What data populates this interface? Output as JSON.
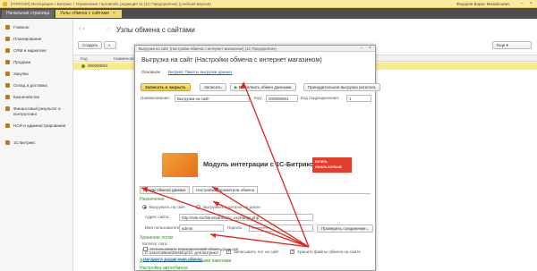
{
  "titlebar": {
    "title": "[УПРОЭП] Интеграция с Битрикс / Управление торговлей, редакция 11 (1С:Предприятие) (учебная версия)",
    "user": "Федоров Борис Михайлович"
  },
  "tabs": [
    {
      "label": "Начальная страница"
    },
    {
      "label": "Узлы обмена с сайтами",
      "close": "×"
    }
  ],
  "sidebar": {
    "items": [
      {
        "label": "Главное"
      },
      {
        "label": "Планирование"
      },
      {
        "label": "CRM и маркетинг"
      },
      {
        "label": "Продажи"
      },
      {
        "label": "Закупки"
      },
      {
        "label": "Склад и доставка"
      },
      {
        "label": "Казначейство"
      },
      {
        "label": "Финансовый результат и контроллинг"
      },
      {
        "label": "НСИ и администрирование"
      },
      {
        "label": "1С-Битрикс"
      }
    ]
  },
  "main": {
    "title": "Узлы обмена с сайтами",
    "toolbar": {
      "create": "Создать",
      "search": "Найти...",
      "more": "Еще"
    },
    "columns": [
      "Код",
      "Наименование"
    ],
    "row": {
      "code": "000000001"
    }
  },
  "dialog": {
    "window_title": "Выгрузка на сайт (Настройки обмена с интернет магазином) (1С:Предприятие)",
    "title": "Выгрузка на сайт (Настройки обмена с интернет магазином)",
    "main_link": "Основное",
    "link_orders": "Битрикс Пакеты выгрузки данных",
    "buttons": {
      "save_close": "Записать и закрыть",
      "save": "Записать",
      "run_exchange": "Выполнить обмен данными",
      "force_upload": "Принудительная выгрузка каталога"
    },
    "name_label": "Наименование:",
    "name_value": "Выгрузка на сайт",
    "code_label": "Код:",
    "code_value": "000000001",
    "node_label": "Код подразделения:",
    "node_value": "1",
    "banner": {
      "text": "Модуль интеграции с 1С-Битрикс 7.х",
      "cta1": "КУПИТЬ",
      "cta2": "УЗНАТЬ БОЛЬШЕ"
    },
    "inner_tabs": [
      "Режим обмена данных",
      "Настройка параметров обмена"
    ],
    "section_purpose": "Назначение",
    "radio_upload": "Выгружать на сайт",
    "radio_catalog": "Выгружать в каталог на диске",
    "site_label": "Адрес сайта:",
    "site_value": "http://site.loc/bitrix/admin/1c_exchange.php",
    "user_label": "Имя пользователя:",
    "user_value": "admin",
    "pass_label": "Пароль:",
    "pass_value": "************",
    "check_conn": "Проверить соединение...",
    "section_logs": "Хранение логов",
    "catalog_label": "Каталог лога:",
    "catalog_value": "C:\\Users\\Иван\\Desktop\\1С для Битрикс\\",
    "chk_log": "Записывать лог на сайт",
    "chk_files": "Хранить файлы обмена на сайте",
    "section_actions": "Действия с ранее отправленными пакетами",
    "section_auto": "Настройка автообмена",
    "chk_auto": "Использовать периодический обмен данными",
    "auto_link": "Настроить расписание обмена"
  }
}
